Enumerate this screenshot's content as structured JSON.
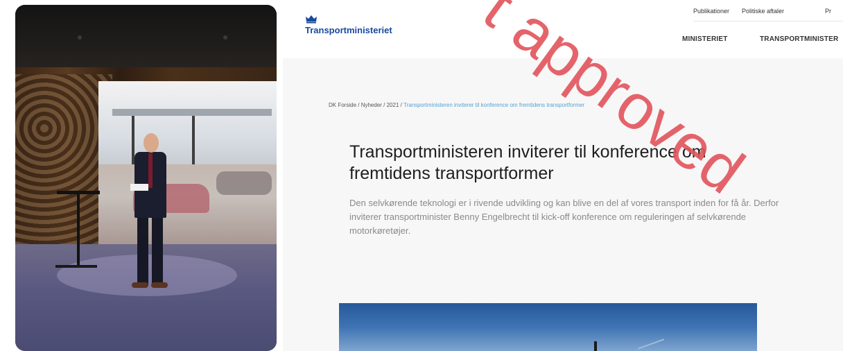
{
  "site": {
    "logo_text": "Transportministeriet",
    "utility_nav": [
      "Publikationer",
      "Politiske aftaler",
      "Pr"
    ],
    "main_nav": [
      "MINISTERIET",
      "TRANSPORTMINISTER"
    ],
    "breadcrumb": {
      "items": [
        "DK Forside",
        "Nyheder",
        "2021"
      ],
      "separator": " / ",
      "current": "Transportministeren inviterer til konference om fremtidens transportformer"
    },
    "article": {
      "title": "Transportministeren inviterer til konference om fremtidens transportformer",
      "lead": "Den selvkørende teknologi er i rivende udvikling og kan blive en del af vores transport inden for få år. Derfor inviterer transportminister Benny Engelbrecht til kick-off konference om reguleringen af selvkørende motorkøretøjer."
    }
  },
  "watermark": {
    "text": "t approved"
  },
  "colors": {
    "brand_blue": "#1a4aa0",
    "breadcrumb_link": "#4fa3d4",
    "watermark": "#e2545c"
  }
}
